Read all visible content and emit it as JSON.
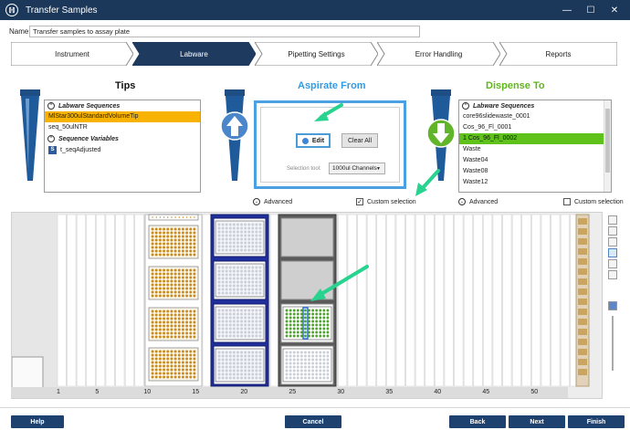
{
  "window": {
    "title": "Transfer Samples",
    "logo": "ℍ",
    "controls": {
      "minimize": "—",
      "maximize": "☐",
      "close": "✕"
    }
  },
  "name_field": {
    "label": "Name",
    "value": "Transfer samples to assay plate"
  },
  "steps": [
    {
      "label": "Instrument",
      "active": false
    },
    {
      "label": "Labware",
      "active": true
    },
    {
      "label": "Pipetting Settings",
      "active": false
    },
    {
      "label": "Error Handling",
      "active": false
    },
    {
      "label": "Reports",
      "active": false
    }
  ],
  "tips": {
    "heading": "Tips",
    "sequences_header": "Labware Sequences",
    "sequences": [
      "MlStar300ulStandardVolumeTip",
      "seq_50ulNTR"
    ],
    "selected_index": 0,
    "variables_header": "Sequence Variables",
    "variables": [
      {
        "badge": "S",
        "label": "t_seqAdjusted"
      }
    ],
    "advanced_label": "Advanced"
  },
  "aspirate": {
    "heading": "Aspirate From",
    "edit_label": "Edit",
    "clear_label": "Clear All",
    "selection_tool_label": "Selection tool:",
    "selection_tool_value": "1000ul Channels",
    "custom_selection_label": "Custom selection",
    "custom_selection_checked": true,
    "check_mark": "✓"
  },
  "dispense": {
    "heading": "Dispense To",
    "sequences_header": "Labware Sequences",
    "sequences": [
      "core96slidewaste_0001",
      "Cos_96_Fl_0001",
      "1 Cos_96_Fl_0002",
      "Waste",
      "Waste04",
      "Waste08",
      "Waste12"
    ],
    "selected_index": 2,
    "advanced_label": "Advanced",
    "custom_selection_label": "Custom selection",
    "custom_selection_checked": false
  },
  "deck_axis": [
    "1",
    "5",
    "10",
    "15",
    "20",
    "25",
    "30",
    "35",
    "40",
    "45",
    "50"
  ],
  "buttons": {
    "help": "Help",
    "cancel": "Cancel",
    "back": "Back",
    "next": "Next",
    "finish": "Finish"
  },
  "colors": {
    "titlebar": "#1b3759",
    "step_active": "#1e3a5f",
    "tips_heading": "#111111",
    "aspirate_heading": "#2e9be6",
    "dispense_heading": "#5eb61a",
    "tip_orange": "#f7b300",
    "dispense_selected": "#5ec21a",
    "annotation_arrow": "#27d38f",
    "plate_tip": "#c98a1e",
    "plate_well": "#c9cfd9",
    "sample_well": "#4da52c",
    "carrier_blue": "#1f2f9c"
  }
}
